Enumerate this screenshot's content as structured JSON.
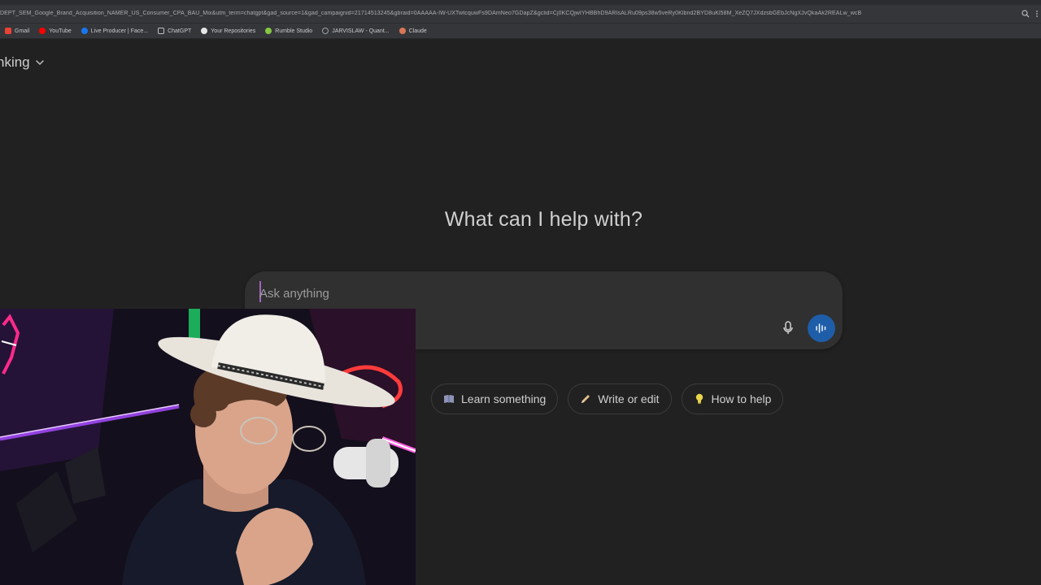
{
  "browser": {
    "url": "DEPT_SEM_Google_Brand_Acquisition_NAMER_US_Consumer_CPA_BAU_Mix&utm_term=chatgpt&gad_source=1&gad_campaignid=21714513245&gbraid=0AAAAA-IW-UXTwtcquwFs9DAmNeo7GDapZ&gclid=Cj0KCQjwIYHBBhD9ARIsALRu09ps38w5veRy0Klbnd2BYD8uKl58M_XeZQ7JXdzsbGEbJcNgXJvQkaAk2REALw_wcB",
    "bookmarks": [
      {
        "label": "Gmail",
        "color": "#ea4335"
      },
      {
        "label": "YouTube",
        "color": "#ff0000"
      },
      {
        "label": "Live Producer | Face...",
        "color": "#1877f2"
      },
      {
        "label": "ChatGPT",
        "color": "#bfbfbf"
      },
      {
        "label": "Your Repositories",
        "color": "#e6e6e6"
      },
      {
        "label": "Rumble Studio",
        "color": "#85c742"
      },
      {
        "label": "JARVISLAW - Quant...",
        "color": "#9aa0a6"
      },
      {
        "label": "Claude",
        "color": "#d97757"
      }
    ]
  },
  "page": {
    "model_label": "nking",
    "hero_title": "What can I help with?",
    "composer": {
      "placeholder": "Ask anything",
      "value": ""
    },
    "suggestions": [
      {
        "label": "Learn something",
        "icon": "book-icon",
        "color": "#9aa0c8"
      },
      {
        "label": "Write or edit",
        "icon": "pencil-icon",
        "color": "#e2c08d"
      },
      {
        "label": "How to help",
        "icon": "lightbulb-icon",
        "color": "#e8d44d"
      }
    ],
    "accent_color": "#1e5da8"
  }
}
